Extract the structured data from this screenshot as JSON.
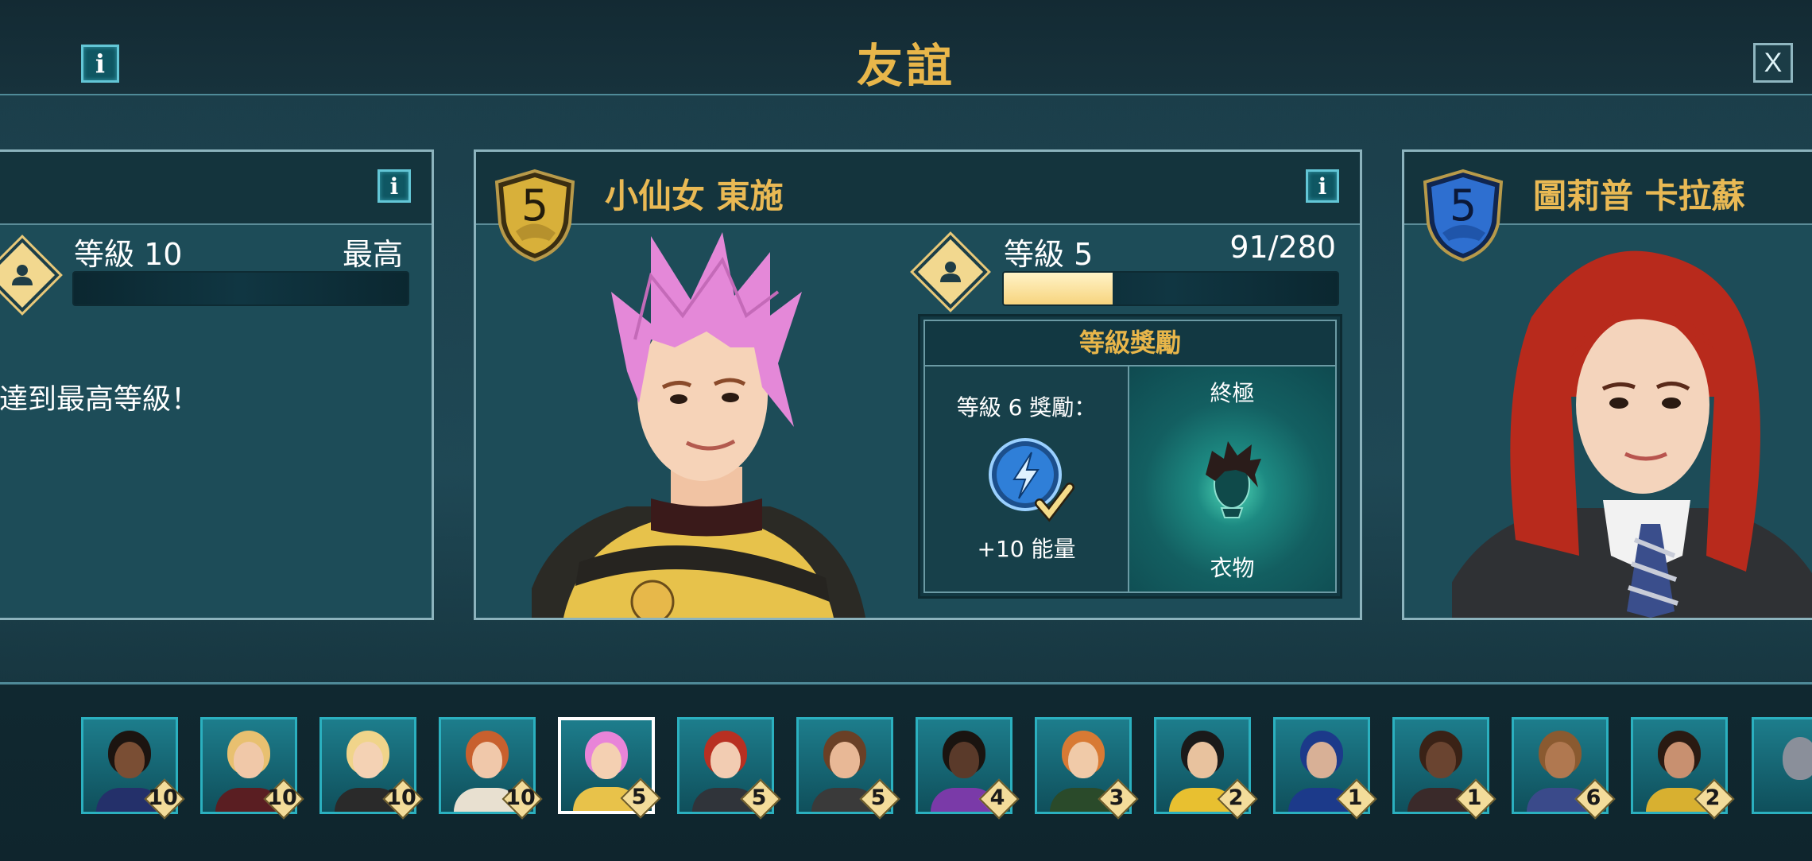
{
  "header": {
    "title": "友誼",
    "info_glyph": "i",
    "close_glyph": "X"
  },
  "left_card": {
    "info_glyph": "i",
    "level_label": "等級 10",
    "level_value_text": "最高",
    "progress": 0,
    "message": "達到最高等級！"
  },
  "center_card": {
    "house_rank": "5",
    "name": "小仙女 東施",
    "info_glyph": "i",
    "level_label": "等級 5",
    "xp_text": "91/280",
    "progress": 0.325,
    "rewards": {
      "heading": "等級獎勵",
      "left_label": "等級 6 獎勵：",
      "left_reward": "+10 能量",
      "right_title": "終極",
      "right_label": "衣物"
    }
  },
  "right_card": {
    "house_rank": "5",
    "name": "圖莉普 卡拉蘇"
  },
  "friends": [
    {
      "level": "10",
      "hair": "#1c1410",
      "skin": "#7a4e34",
      "robe": "#24306a",
      "active": false
    },
    {
      "level": "10",
      "hair": "#e8c070",
      "skin": "#f0c8a8",
      "robe": "#5a1e22",
      "active": false
    },
    {
      "level": "10",
      "hair": "#f0d48a",
      "skin": "#f4d2b4",
      "robe": "#2a2a2a",
      "active": false
    },
    {
      "level": "10",
      "hair": "#c8602e",
      "skin": "#f0c8aa",
      "robe": "#e8e0d0",
      "active": false
    },
    {
      "level": "5",
      "hair": "#e884d8",
      "skin": "#f4d0b2",
      "robe": "#e8c24a",
      "active": true
    },
    {
      "level": "5",
      "hair": "#b83022",
      "skin": "#f2ccb2",
      "robe": "#30343a",
      "active": false
    },
    {
      "level": "5",
      "hair": "#6a4026",
      "skin": "#e8b896",
      "robe": "#3a3a3a",
      "active": false
    },
    {
      "level": "4",
      "hair": "#1a1410",
      "skin": "#5a3a2a",
      "robe": "#7a3aa8",
      "active": false
    },
    {
      "level": "3",
      "hair": "#d87a34",
      "skin": "#f0caa8",
      "robe": "#2a4a2a",
      "active": false
    },
    {
      "level": "2",
      "hair": "#1a1a1a",
      "skin": "#e8c29e",
      "robe": "#e8c030",
      "active": false
    },
    {
      "level": "1",
      "hair": "#1c3a8a",
      "skin": "#d8b096",
      "robe": "#1c3a8a",
      "active": false
    },
    {
      "level": "1",
      "hair": "#3a2216",
      "skin": "#6a4430",
      "robe": "#3a2a2a",
      "active": false
    },
    {
      "level": "6",
      "hair": "#8a5a30",
      "skin": "#b07850",
      "robe": "#3a4a8a",
      "active": false
    },
    {
      "level": "2",
      "hair": "#2a1a12",
      "skin": "#c89070",
      "robe": "#d8b030",
      "active": false
    }
  ],
  "colors": {
    "accent_gold": "#e8b64a",
    "teal_border": "#2bb0bf",
    "card_bg": "#1d4c58",
    "hufflepuff": "#d8b03a",
    "ravenclaw": "#2e6fd0"
  }
}
